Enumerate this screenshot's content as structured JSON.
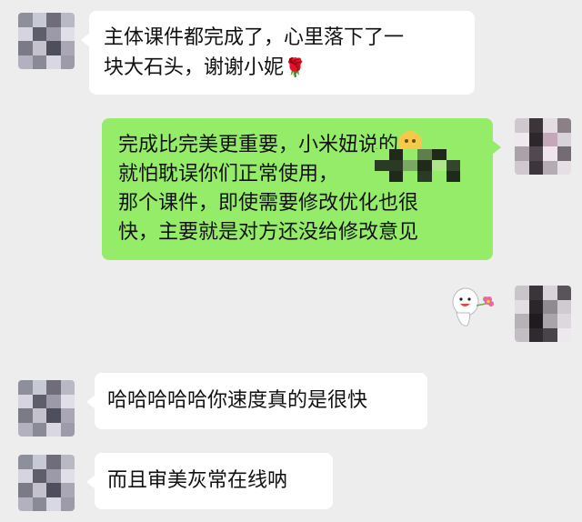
{
  "messages": [
    {
      "side": "left",
      "lines": [
        "主体课件都完成了，心里落下了一",
        "块大石头，谢谢小妮"
      ],
      "emoji": "rose-icon"
    },
    {
      "side": "right",
      "lines": [
        "完成比完美更重要，小米妞说的",
        "就怕耽误你们正常使用，",
        "那个课件，即使需要修改优化也很",
        "快，主要就是对方还没给修改意见"
      ],
      "emoji": "grin-face-icon"
    },
    {
      "side": "right",
      "sticker": "flower-sticker"
    },
    {
      "side": "left",
      "lines": [
        "哈哈哈哈哈你速度真的是很快"
      ]
    },
    {
      "side": "left",
      "lines": [
        "而且审美灰常在线呐"
      ]
    }
  ],
  "colors": {
    "background": "#EDEDED",
    "bubble_left": "#FFFFFF",
    "bubble_right": "#95EC69"
  }
}
